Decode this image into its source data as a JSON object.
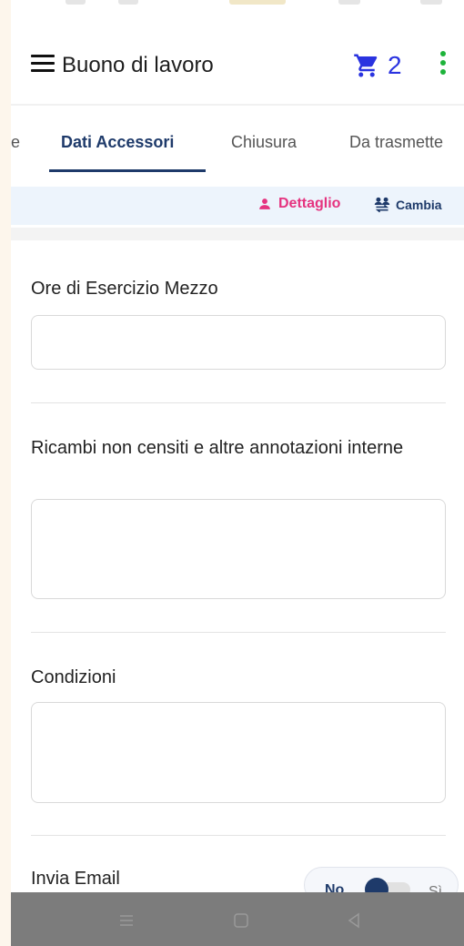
{
  "app": {
    "title": "Buono di lavoro",
    "cart_count": "2",
    "accent_color": "#2a33e0",
    "menu_dots_color": "#1db33a"
  },
  "tabs": [
    {
      "label": "e",
      "active": false
    },
    {
      "label": "Dati Accessori",
      "active": true
    },
    {
      "label": "Chiusura",
      "active": false
    },
    {
      "label": "Da trasmette",
      "active": false
    }
  ],
  "actions": {
    "dettaglio_label": "Dettaglio",
    "cambia_label": "Cambia"
  },
  "form": {
    "ore_label": "Ore di Esercizio Mezzo",
    "ore_value": "",
    "ricambi_label": "Ricambi non censiti e altre annotazioni interne",
    "ricambi_value": "",
    "condizioni_label": "Condizioni",
    "condizioni_value": "",
    "invia_label": "Invia Email",
    "toggle_no": "No",
    "toggle_si": "Sì",
    "toggle_state": "No"
  },
  "icons": {
    "menu": "hamburger-icon",
    "cart": "cart-icon",
    "more": "kebab-menu-icon",
    "dettaglio": "person-icon",
    "cambia": "swap-users-icon",
    "nav_recent": "recent-apps-icon",
    "nav_home": "home-icon",
    "nav_back": "back-icon"
  }
}
